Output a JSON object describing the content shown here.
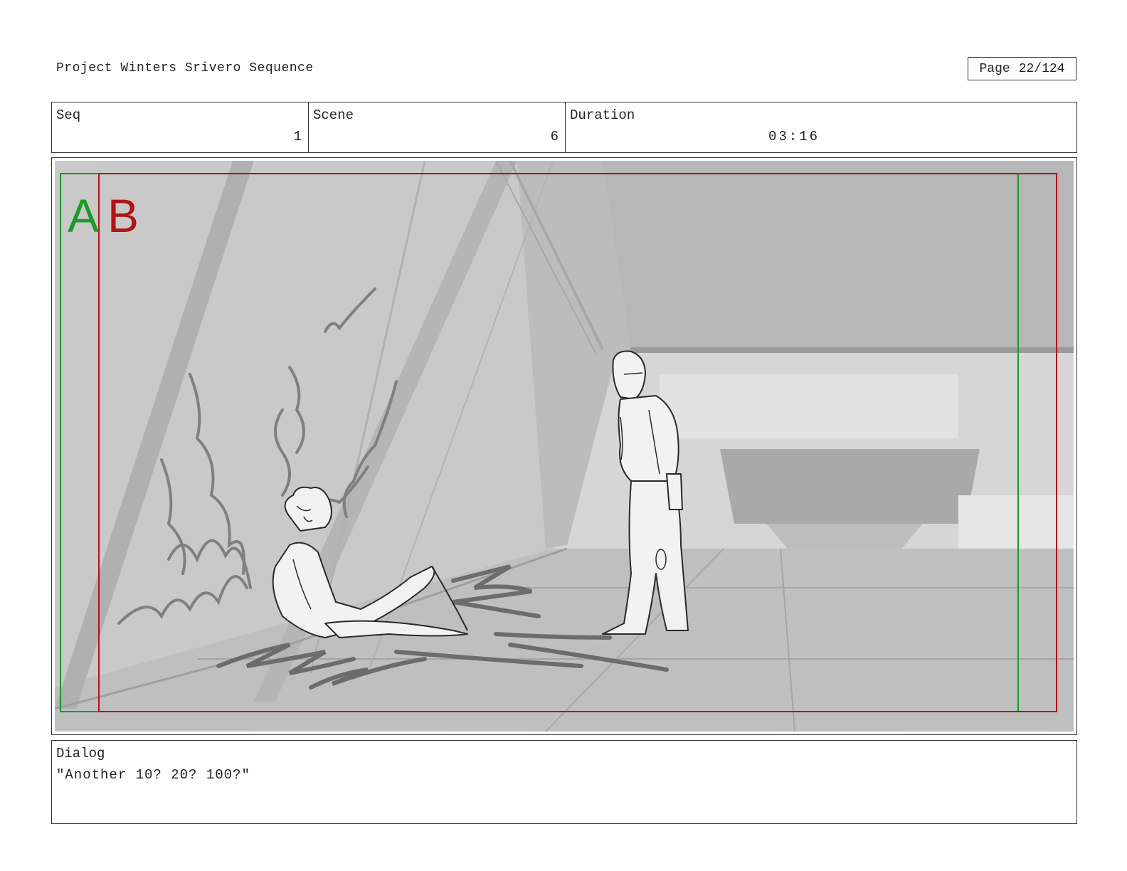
{
  "header": {
    "project_title": "Project Winters Srivero Sequence",
    "page_label": "Page",
    "page_value": "22/124"
  },
  "info": {
    "seq_label": "Seq",
    "seq_value": "1",
    "scene_label": "Scene",
    "scene_value": "6",
    "duration_label": "Duration",
    "duration_value": "03:16"
  },
  "panel": {
    "safe_label_a": "A",
    "safe_label_b": "B",
    "colors": {
      "a": "#1a9a2a",
      "b": "#b01515",
      "sketch": "#2a2a2a",
      "bg": "#c8c8c8"
    }
  },
  "dialog": {
    "label": "Dialog",
    "line": "\"Another 10? 20? 100?\""
  }
}
